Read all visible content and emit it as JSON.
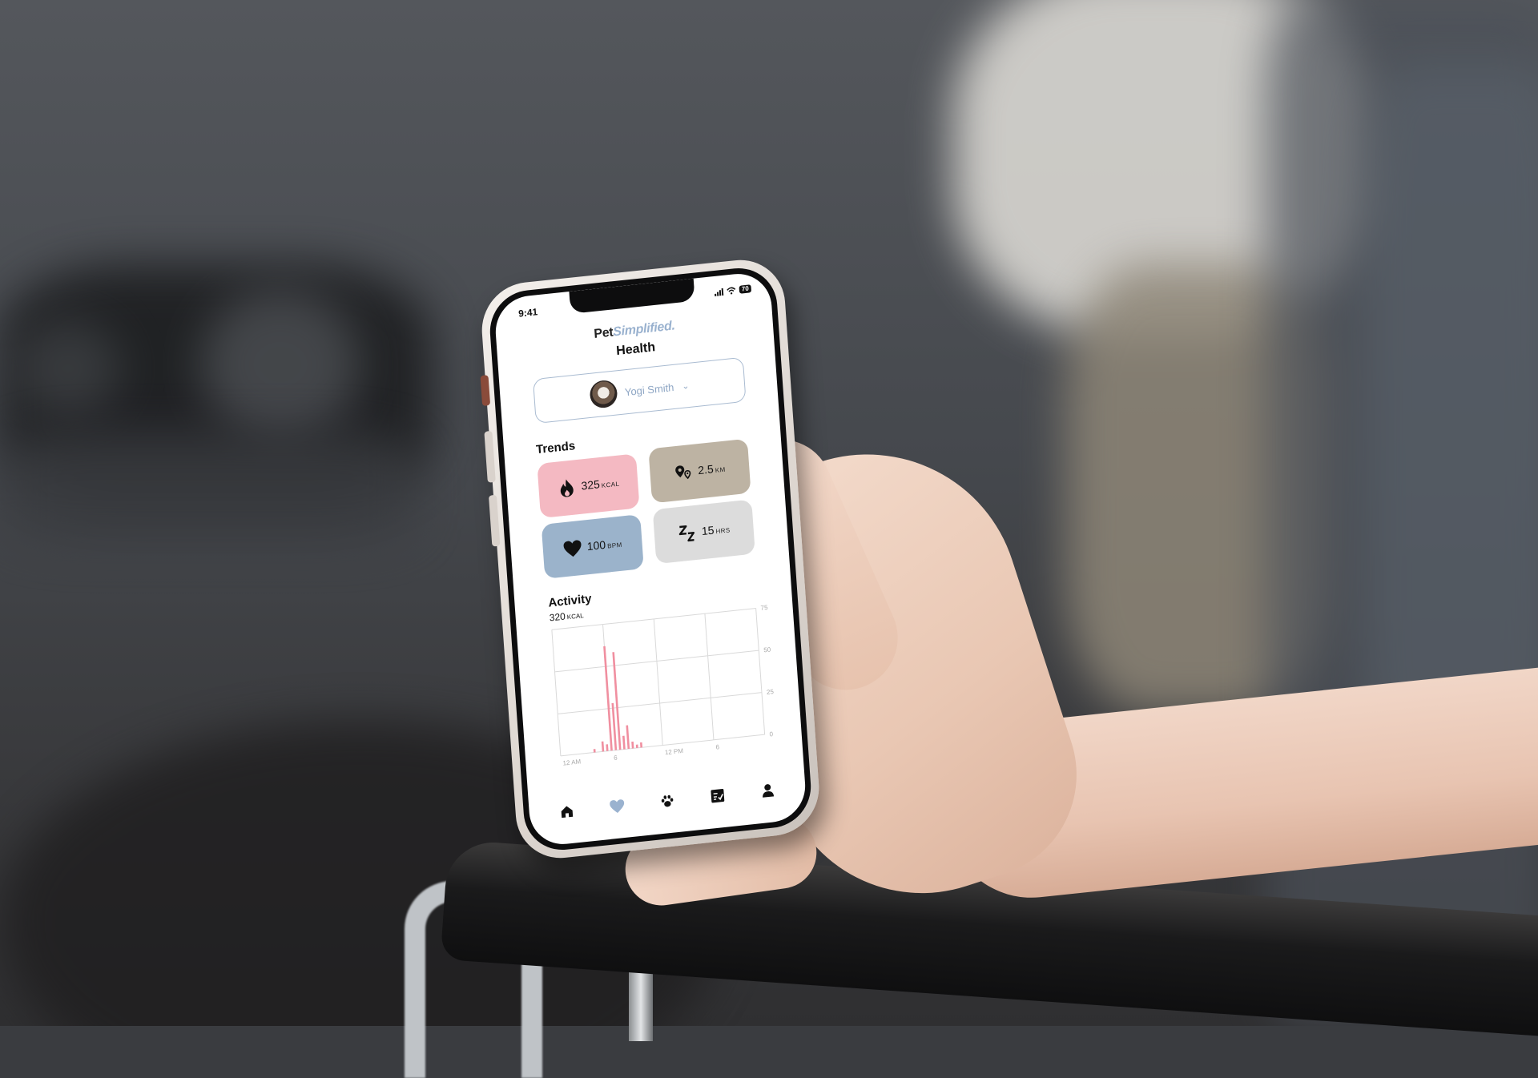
{
  "status_bar": {
    "time": "9:41",
    "battery": "70"
  },
  "app": {
    "brand_primary": "Pet",
    "brand_accent": "Simplified.",
    "page_title": "Health"
  },
  "pet_selector": {
    "name": "Yogi Smith",
    "chevron_icon": "chevron-down-icon"
  },
  "trends": {
    "label": "Trends",
    "tiles": [
      {
        "icon": "flame-icon",
        "value": "325",
        "unit": "KCAL",
        "color": "#f4b9c2"
      },
      {
        "icon": "location-pin-icon",
        "value": "2.5",
        "unit": "KM",
        "color": "#bdb3a3"
      },
      {
        "icon": "heart-icon",
        "value": "100",
        "unit": "BPM",
        "color": "#9bb3cb"
      },
      {
        "icon": "sleep-icon",
        "value": "15",
        "unit": "HRS",
        "color": "#dcdcdc"
      }
    ]
  },
  "activity": {
    "label": "Activity",
    "total_value": "320",
    "total_unit": "KCAL"
  },
  "chart_data": {
    "type": "bar",
    "x_tick_labels": [
      "12 AM",
      "6",
      "12 PM",
      "6"
    ],
    "y_tick_labels": [
      "75",
      "50",
      "25",
      "0"
    ],
    "ylim": [
      0,
      75
    ],
    "grid": true,
    "color": "#f08fa0",
    "x": [
      4,
      5,
      5.5,
      6,
      6.5,
      7,
      7.5,
      8,
      8.5,
      9,
      9.5
    ],
    "values": [
      2,
      6,
      4,
      62,
      28,
      58,
      8,
      14,
      4,
      2,
      3
    ]
  },
  "tab_bar": {
    "tabs": [
      {
        "name": "home-icon",
        "active": false
      },
      {
        "name": "heart-icon",
        "active": true
      },
      {
        "name": "paw-icon",
        "active": false
      },
      {
        "name": "checklist-icon",
        "active": false
      },
      {
        "name": "profile-icon",
        "active": false
      }
    ],
    "active_color": "#9ab2cf"
  }
}
